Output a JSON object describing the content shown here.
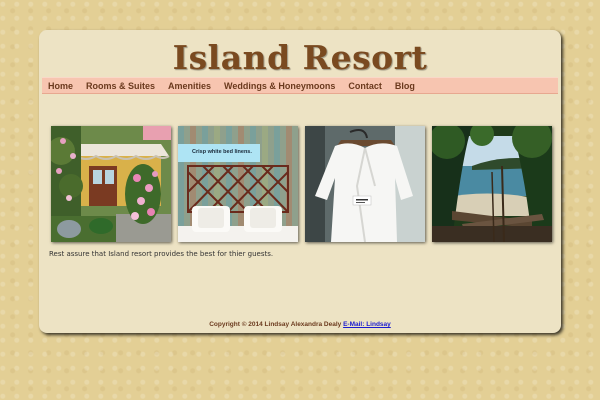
{
  "site": {
    "title": "Island Resort"
  },
  "nav": {
    "items": [
      {
        "label": "Home"
      },
      {
        "label": "Rooms & Suites"
      },
      {
        "label": "Amenities"
      },
      {
        "label": "Weddings & Honeymoons"
      },
      {
        "label": "Contact"
      },
      {
        "label": "Blog"
      }
    ]
  },
  "gallery": {
    "caption": "Crisp white bed linens."
  },
  "main": {
    "description": "Rest assure that Island resort provides the best for thier guests."
  },
  "footer": {
    "copyright": "Copyright © 2014 Lindsay Alexandra Dealy",
    "email_link": "E-Mail: Lindsay"
  }
}
